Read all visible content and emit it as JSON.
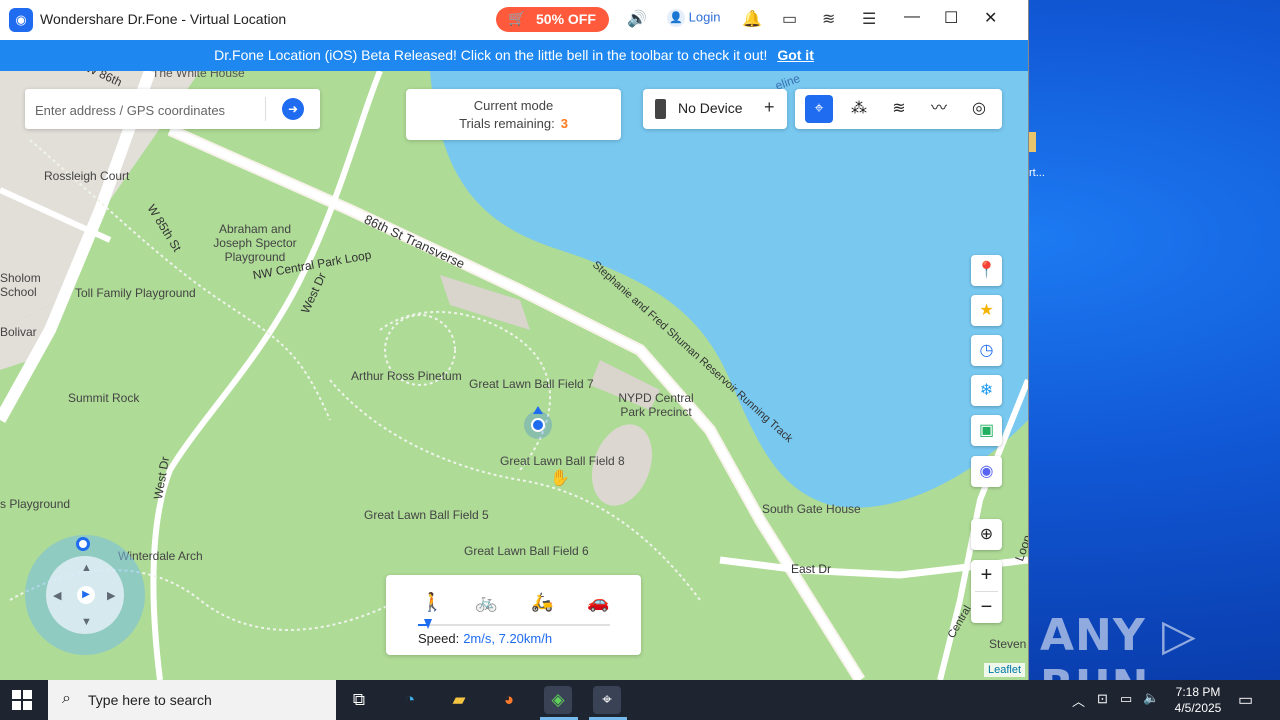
{
  "window": {
    "title": "Wondershare Dr.Fone - Virtual Location",
    "promo": "50% OFF",
    "login": "Login",
    "controls": {
      "minimize": "—",
      "maximize": "☐",
      "close": "✕"
    }
  },
  "banner": {
    "message": "Dr.Fone Location (iOS) Beta Released! Click on the little bell in the toolbar to check it out!",
    "action": "Got it"
  },
  "search": {
    "placeholder": "Enter address / GPS coordinates"
  },
  "mode_box": {
    "line1": "Current mode",
    "trials_label": "Trials remaining:",
    "trials_value": "3"
  },
  "device": {
    "label": "No Device",
    "add": "+"
  },
  "mode_buttons": [
    "teleport",
    "multi-stop",
    "two-spot",
    "jump",
    "joystick"
  ],
  "side_buttons": [
    "google-maps",
    "favorites",
    "history",
    "freeze",
    "route-import",
    "discord"
  ],
  "zoom": {
    "in": "+",
    "out": "−"
  },
  "speed": {
    "label": "Speed:",
    "value": "2m/s, 7.20km/h",
    "level": 0.05,
    "modes": [
      "walk",
      "bike",
      "scooter",
      "car"
    ]
  },
  "map": {
    "attribution": "Leaflet",
    "labels": [
      "The White House",
      "W 86th",
      "Rossleigh Court",
      "W 85th St",
      "Abraham and Joseph Spector Playground",
      "NW Central Park Loop",
      "86th St Transverse",
      "Stephanie and Fred Shuman Reservoir Running Track",
      "Sholom School",
      "Toll Family Playground",
      "Bolivar",
      "West Dr",
      "Arthur Ross Pinetum",
      "Great Lawn Ball Field 7",
      "NYPD Central Park Precinct",
      "Summit Rock",
      "Great Lawn Ball Field 8",
      "Great Lawn Ball Field 5",
      "Great Lawn Ball Field 6",
      "South Gate House",
      "East Dr",
      "Loop",
      "Winterdale Arch",
      "s Playground",
      "Central",
      "Steven",
      "eline"
    ]
  },
  "desktop": {
    "icon_label": "rt...",
    "watermark": "ANY ▷ RUN"
  },
  "taskbar": {
    "search_placeholder": "Type here to search",
    "time": "7:18 PM",
    "date": "4/5/2025"
  }
}
